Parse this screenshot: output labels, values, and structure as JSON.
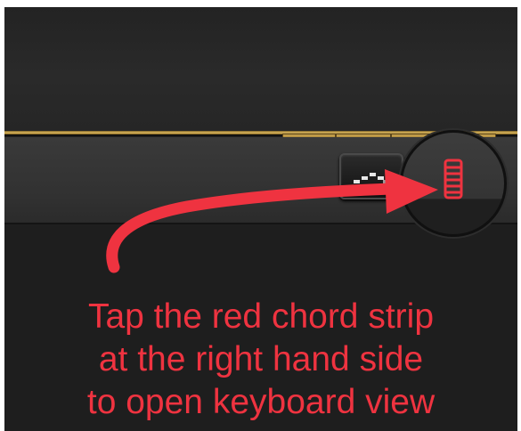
{
  "instruction": {
    "lines": [
      "Tap the red chord strip",
      "at the right hand side",
      "to open keyboard view"
    ]
  },
  "icons": {
    "arpeggiator": "arpeggiator-icon",
    "chord_strip": "chord-strip-icon",
    "callout_arrow": "curved-arrow-icon"
  },
  "colors": {
    "accent_red": "#ef3340",
    "gold_rail": "#c9a34d",
    "panel_dark": "#1c1c1c"
  }
}
